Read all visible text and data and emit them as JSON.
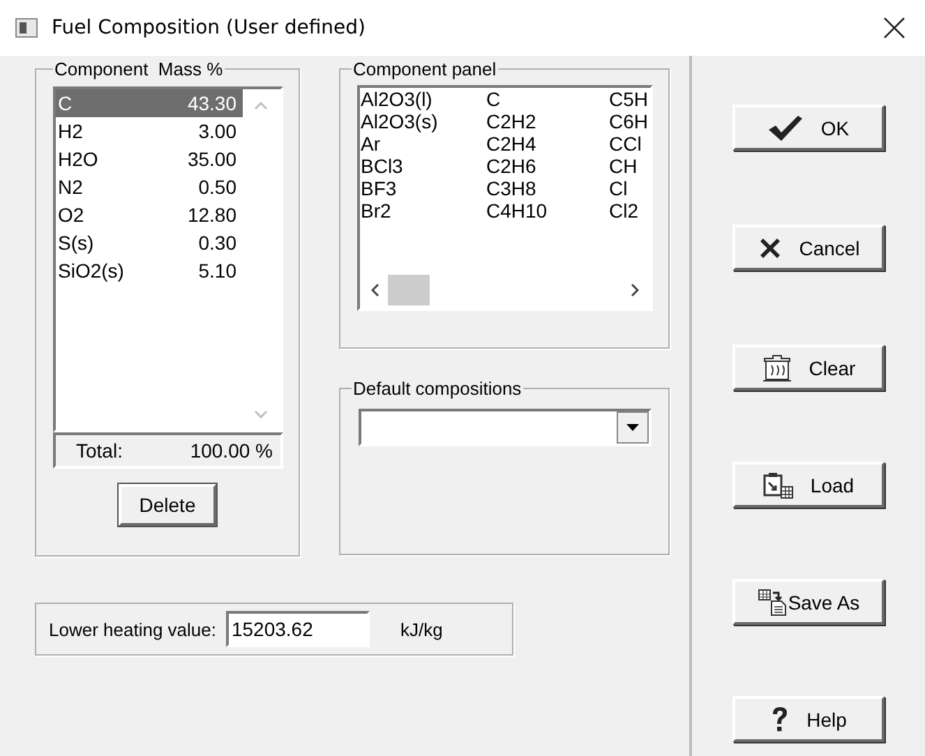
{
  "window": {
    "title": "Fuel Composition (User defined)"
  },
  "component_group": {
    "title": "Component  Mass %",
    "rows": [
      {
        "name": "C",
        "mass": "43.30",
        "selected": true
      },
      {
        "name": "H2",
        "mass": "3.00",
        "selected": false
      },
      {
        "name": "H2O",
        "mass": "35.00",
        "selected": false
      },
      {
        "name": "N2",
        "mass": "0.50",
        "selected": false
      },
      {
        "name": "O2",
        "mass": "12.80",
        "selected": false
      },
      {
        "name": "S(s)",
        "mass": "0.30",
        "selected": false
      },
      {
        "name": "SiO2(s)",
        "mass": "5.10",
        "selected": false
      }
    ],
    "total_label": "Total:",
    "total_value": "100.00 %",
    "delete_button": "Delete"
  },
  "component_panel": {
    "title": "Component panel",
    "columns": [
      [
        "Al2O3(l)",
        "Al2O3(s)",
        "Ar",
        "BCl3",
        "BF3",
        "Br2"
      ],
      [
        "C",
        "C2H2",
        "C2H4",
        "C2H6",
        "C3H8",
        "C4H10"
      ],
      [
        "C5H",
        "C6H",
        "CCl",
        "CH",
        "Cl",
        "Cl2"
      ]
    ]
  },
  "default_compositions": {
    "title": "Default compositions"
  },
  "heating_value": {
    "label": "Lower heating value:",
    "value": "15203.62",
    "unit": "kJ/kg"
  },
  "buttons": [
    {
      "label": "OK",
      "kind": "ok"
    },
    {
      "label": "Cancel",
      "kind": "cancel"
    },
    {
      "label": "Clear",
      "kind": "clear"
    },
    {
      "label": "Load",
      "kind": "load"
    },
    {
      "label": "Save As",
      "kind": "save_as"
    },
    {
      "label": "Help",
      "kind": "help"
    }
  ]
}
